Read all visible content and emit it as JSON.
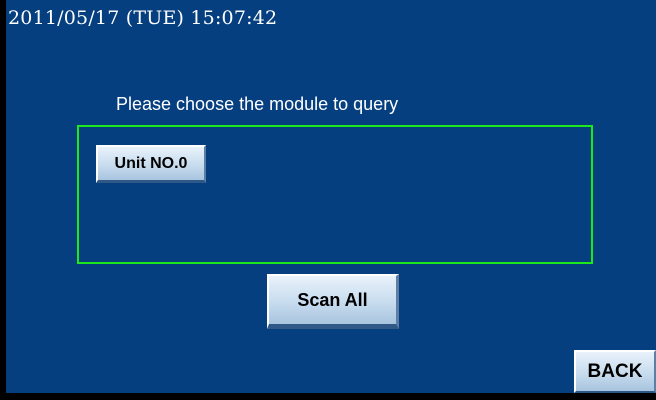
{
  "status_bar": {
    "datetime": "2011/05/17 (TUE) 15:07:42"
  },
  "main": {
    "prompt": "Please choose the module to query",
    "modules": [
      {
        "label": "Unit NO.0"
      }
    ],
    "scan_all_label": "Scan All"
  },
  "footer": {
    "back_label": "BACK"
  },
  "colors": {
    "background": "#053f80",
    "box_border": "#1ce81c",
    "text": "#ffffff",
    "button_face": "#c7dcee"
  }
}
